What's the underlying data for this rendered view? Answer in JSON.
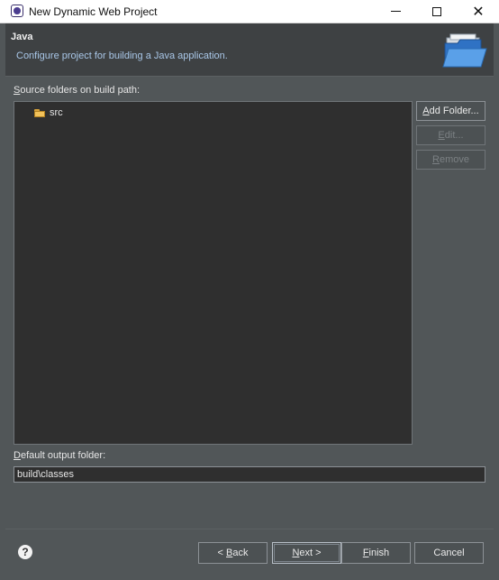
{
  "window": {
    "title": "New Dynamic Web Project",
    "minimize_icon": "minimize-icon",
    "maximize_icon": "maximize-icon",
    "close_icon": "close-icon"
  },
  "header": {
    "title": "Java",
    "description": "Configure project for building a Java application.",
    "banner_icon": "open-folder-icon"
  },
  "source": {
    "label_mnemonic": "S",
    "label_rest": "ource folders on build path:",
    "items": [
      {
        "label": "src",
        "icon": "source-folder-icon"
      }
    ]
  },
  "side_buttons": {
    "add_folder_m": "A",
    "add_folder_rest": "dd Folder...",
    "edit_m": "E",
    "edit_rest": "dit...",
    "remove_m": "R",
    "remove_rest": "emove"
  },
  "output": {
    "label_mnemonic": "D",
    "label_rest": "efault output folder:",
    "value": "build\\classes"
  },
  "footer": {
    "help_icon": "help-icon",
    "back_pre": "< ",
    "back_m": "B",
    "back_rest": "ack",
    "next_m": "N",
    "next_rest": "ext >",
    "finish_m": "F",
    "finish_rest": "inish",
    "cancel": "Cancel"
  },
  "colors": {
    "dialog_background": "#515658",
    "header_background": "#3e4143",
    "description_text": "#a9c7e8",
    "list_background": "#2f2f2f"
  }
}
